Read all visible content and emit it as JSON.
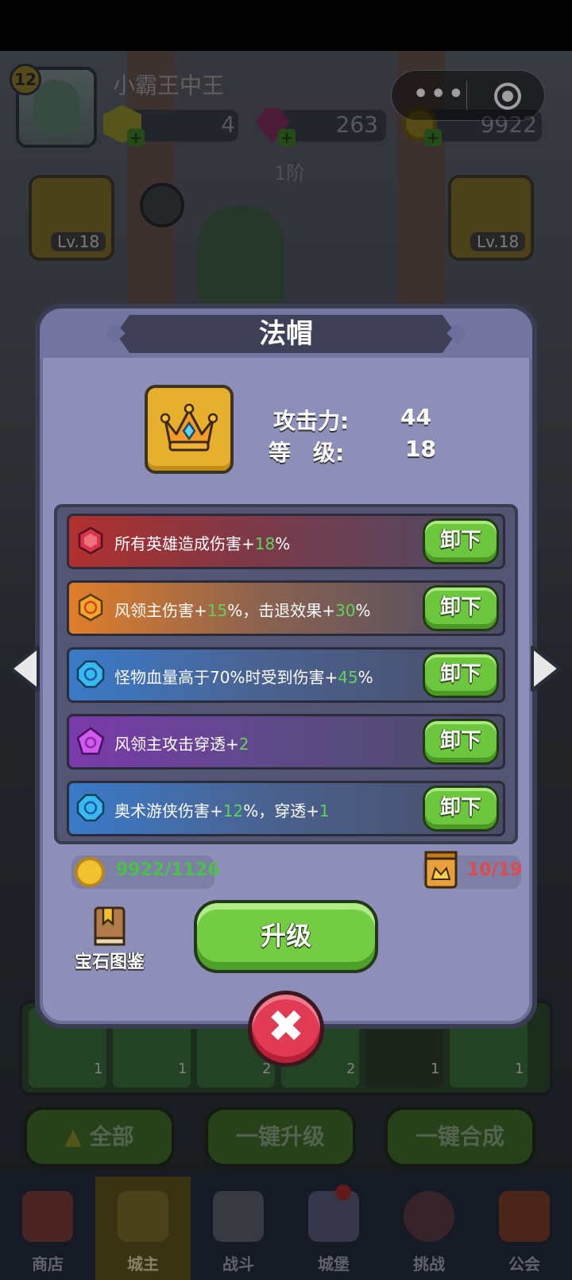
{
  "player": {
    "level": "12",
    "name": "小霸王中王"
  },
  "resources": {
    "gems": "4",
    "rubies": "263",
    "coins": "9922",
    "tier": "1阶"
  },
  "equip_slots": {
    "left_level": "Lv.18",
    "right_level": "Lv.18"
  },
  "modal": {
    "title": "法帽",
    "item_icon": "crown-icon",
    "stats": [
      {
        "label": "攻击力:",
        "value": "44"
      },
      {
        "label": "等　级:",
        "value": "18"
      }
    ],
    "gems": [
      {
        "pre": "所有英雄造成伤害+",
        "num": "18",
        "post": "%",
        "mid": "",
        "num2": "",
        "post2": "",
        "color": "#c0392b",
        "icon": "red-gem-icon",
        "button": "卸下"
      },
      {
        "pre": "风领主伤害+",
        "num": "15",
        "post": "%，击退效果+",
        "num2": "30",
        "post2": "%",
        "color": "#e07a2a",
        "icon": "orange-gem-icon",
        "button": "卸下"
      },
      {
        "pre": "怪物血量高于70%时受到伤害+",
        "num": "45",
        "post": "%",
        "num2": "",
        "post2": "",
        "color": "#3a7ac8",
        "icon": "blue-gem-icon",
        "button": "卸下"
      },
      {
        "pre": "风领主攻击穿透+",
        "num": "2",
        "post": "",
        "num2": "",
        "post2": "",
        "color": "#8a3ac0",
        "icon": "purple-gem-icon",
        "button": "卸下"
      },
      {
        "pre": "奥术游侠伤害+",
        "num": "12",
        "post": "%，穿透+",
        "num2": "1",
        "post2": "",
        "color": "#3a7ac8",
        "icon": "blue-gem-icon",
        "button": "卸下"
      }
    ],
    "gold_cost": "9922/1126",
    "stone_cost": "10/19",
    "codex_label": "宝石图鉴",
    "upgrade_label": "升级",
    "close_symbol": "✖"
  },
  "inventory": {
    "counts": [
      "1",
      "1",
      "2",
      "2",
      "1",
      "1"
    ]
  },
  "bottom_buttons": {
    "all": "全部",
    "one_click_upgrade": "一键升级",
    "one_click_merge": "一键合成"
  },
  "tabs": [
    "商店",
    "城主",
    "战斗",
    "城堡",
    "挑战",
    "公会"
  ],
  "active_tab": "城主"
}
